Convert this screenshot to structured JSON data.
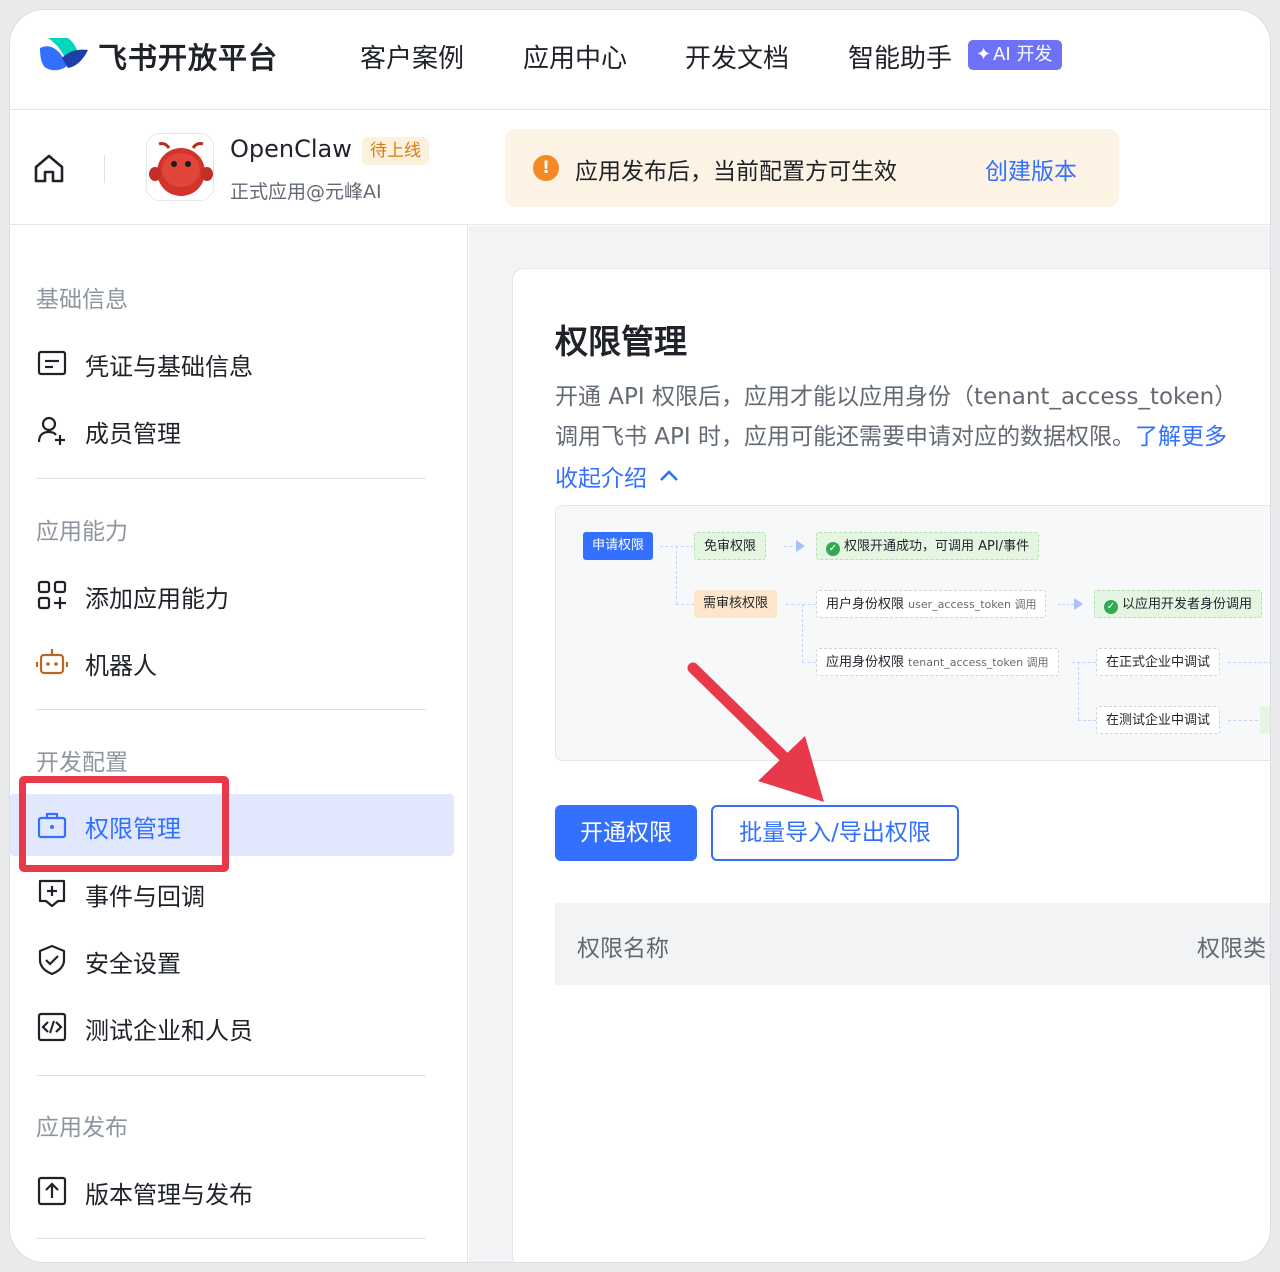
{
  "topnav": {
    "brand": "飞书开放平台",
    "items": [
      "客户案例",
      "应用中心",
      "开发文档",
      "智能助手"
    ],
    "ai_badge": "AI 开发",
    "ai_badge_icon": "sparkle-icon"
  },
  "appbar": {
    "app_name": "OpenClaw",
    "status": "待上线",
    "subtitle": "正式应用@元峰AI",
    "notice_text": "应用发布后，当前配置方可生效",
    "notice_link": "创建版本"
  },
  "sidebar": {
    "sections": [
      {
        "title": "基础信息",
        "items": [
          {
            "label": "凭证与基础信息",
            "icon": "credential-icon"
          },
          {
            "label": "成员管理",
            "icon": "add-member-icon"
          }
        ]
      },
      {
        "title": "应用能力",
        "items": [
          {
            "label": "添加应用能力",
            "icon": "add-capability-icon"
          },
          {
            "label": "机器人",
            "icon": "robot-icon"
          }
        ]
      },
      {
        "title": "开发配置",
        "items": [
          {
            "label": "权限管理",
            "icon": "briefcase-icon",
            "active": true
          },
          {
            "label": "事件与回调",
            "icon": "event-icon"
          },
          {
            "label": "安全设置",
            "icon": "shield-icon"
          },
          {
            "label": "测试企业和人员",
            "icon": "code-icon"
          }
        ]
      },
      {
        "title": "应用发布",
        "items": [
          {
            "label": "版本管理与发布",
            "icon": "upload-icon"
          }
        ]
      }
    ]
  },
  "main": {
    "title": "权限管理",
    "intro_line1": "开通 API 权限后，应用才能以应用身份（tenant_access_token）",
    "intro_line2": "调用飞书 API 时，应用可能还需要申请对应的数据权限。",
    "intro_link": "了解更多",
    "collapse_label": "收起介绍",
    "diagram": {
      "apply": "申请权限",
      "free": "免审权限",
      "success": "权限开通成功，可调用 API/事件",
      "review": "需审核权限",
      "user_perm": "用户身份权限",
      "user_token": "user_access_token 调用",
      "dev_call": "以应用开发者身份调用",
      "app_perm": "应用身份权限",
      "app_token": "tenant_access_token 调用",
      "prod_debug": "在正式企业中调试",
      "test_debug": "在测试企业中调试"
    },
    "btn_enable": "开通权限",
    "btn_batch": "批量导入/导出权限",
    "table_headers": [
      "权限名称",
      "权限类"
    ]
  },
  "colors": {
    "primary": "#3370ff",
    "active_bg": "#e1e8fd",
    "highlight_red": "#e8394a",
    "notice_bg": "#fdf3e4",
    "warning": "#f38a26"
  }
}
